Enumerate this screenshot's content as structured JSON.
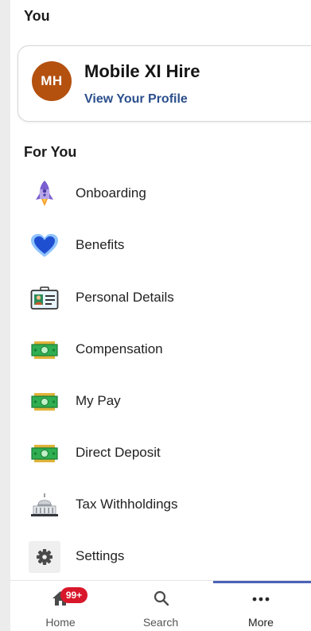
{
  "sections": {
    "you_title": "You",
    "for_you_title": "For You"
  },
  "profile": {
    "initials": "MH",
    "name": "Mobile XI Hire",
    "link_text": "View Your Profile",
    "avatar_color": "#b4510f"
  },
  "menu": [
    {
      "label": "Onboarding",
      "icon": "rocket-icon"
    },
    {
      "label": "Benefits",
      "icon": "heart-icon"
    },
    {
      "label": "Personal Details",
      "icon": "id-card-icon"
    },
    {
      "label": "Compensation",
      "icon": "money-icon"
    },
    {
      "label": "My Pay",
      "icon": "money-icon"
    },
    {
      "label": "Direct Deposit",
      "icon": "money-icon"
    },
    {
      "label": "Tax Withholdings",
      "icon": "capitol-building-icon"
    },
    {
      "label": "Settings",
      "icon": "gear-icon"
    }
  ],
  "tabbar": {
    "home_label": "Home",
    "search_label": "Search",
    "more_label": "More",
    "home_badge": "99+",
    "active_tab": "More",
    "accent_color": "#4a63b8",
    "badge_color": "#d9172b"
  }
}
